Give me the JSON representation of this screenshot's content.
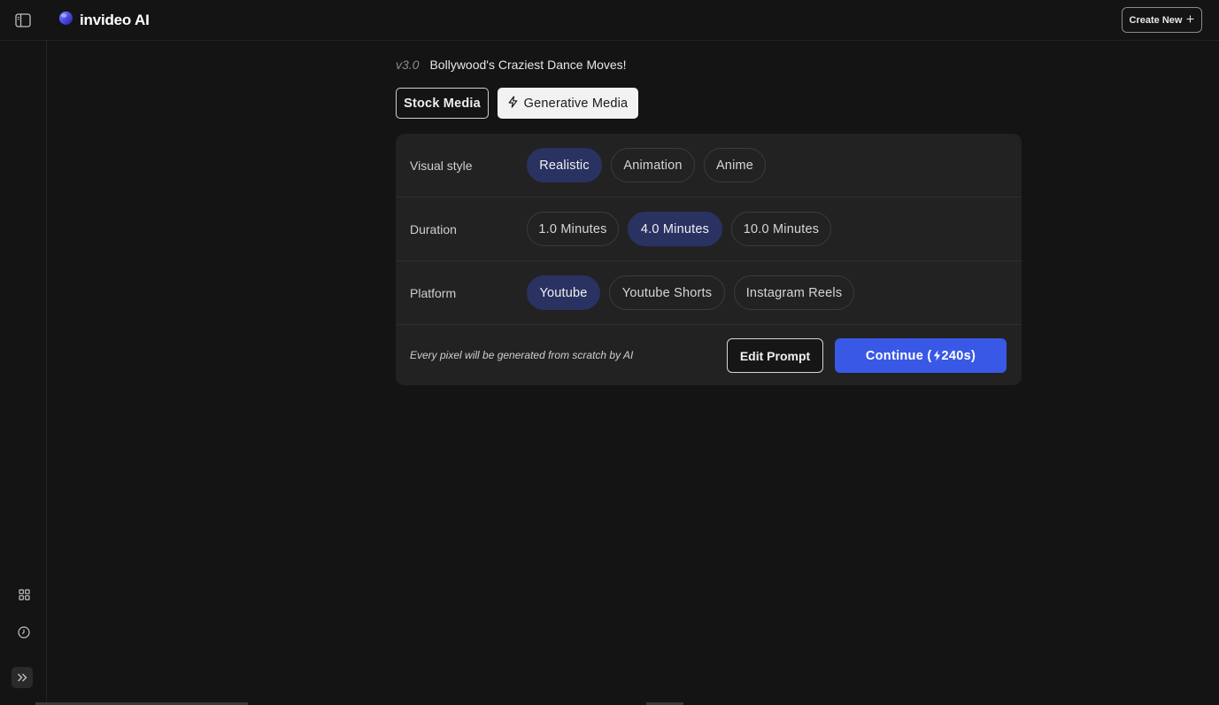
{
  "header": {
    "brand_name": "invideo AI",
    "create_new_label": "Create New",
    "icons": {
      "sidebar_toggle": "sidebar-panel-icon",
      "logo": "invideo-logo-icon",
      "create_new": "plus-icon"
    }
  },
  "sidebar": {
    "icons": [
      "grid-icon",
      "clock-icon",
      "chevrons-right-icon"
    ]
  },
  "project": {
    "version": "v3.0",
    "title": "Bollywood's Craziest Dance Moves!"
  },
  "media_tabs": {
    "stock_label": "Stock Media",
    "generative_label": "Generative Media",
    "selected": "Generative Media",
    "generative_icon": "lightning-icon"
  },
  "settings": {
    "visual_style": {
      "label": "Visual style",
      "options": [
        "Realistic",
        "Animation",
        "Anime"
      ],
      "selected": "Realistic"
    },
    "duration": {
      "label": "Duration",
      "options": [
        "1.0 Minutes",
        "4.0 Minutes",
        "10.0 Minutes"
      ],
      "selected": "4.0 Minutes"
    },
    "platform": {
      "label": "Platform",
      "options": [
        "Youtube",
        "Youtube Shorts",
        "Instagram Reels"
      ],
      "selected": "Youtube"
    }
  },
  "footer": {
    "note": "Every pixel will be generated from scratch by AI",
    "edit_prompt_label": "Edit Prompt",
    "continue_label": "Continue (",
    "continue_cost": "240s)",
    "continue_icon": "lightning-icon"
  },
  "colors": {
    "background": "#141414",
    "panel": "#222222",
    "selected_pill": "#2a3262",
    "accent": "#3a58e6"
  }
}
